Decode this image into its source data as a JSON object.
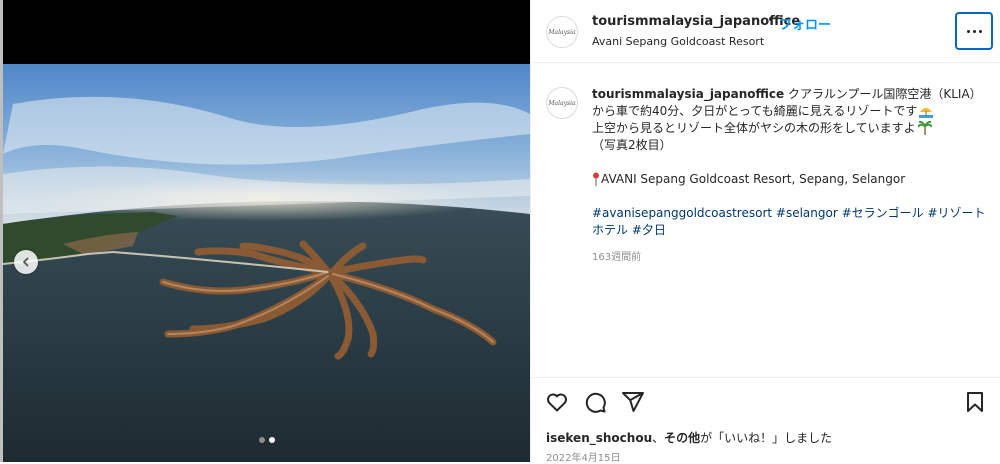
{
  "post": {
    "username": "tourismmalaysia_japanoffice",
    "separator": "•",
    "follow_label": "フォロー",
    "location": "Avani Sepang Goldcoast Resort",
    "avatar_text": "Malaysia",
    "caption": {
      "username": "tourismmalaysia_japanoffice",
      "line1": "クアラルンプール国際空港（KLIA）",
      "line2": "から車で約40分、夕日がとっても綺麗に見えるリゾートです",
      "line3": "上空から見るとリゾート全体がヤシの木の形をしていますよ",
      "line4": "（写真2枚目）",
      "location_line": "AVANI Sepang Goldcoast Resort, Sepang, Selangor",
      "tags_line1": "#avanisepanggoldcoastresort #selangor #セランゴール #リゾート",
      "tags_line2": "ホテル #夕日"
    },
    "time_ago": "163週間前",
    "likes": {
      "user": "iseken_shochou",
      "separator": "、",
      "others": "その他",
      "suffix": "が「いいね！」しました"
    },
    "date": "2022年4月15日"
  },
  "carousel": {
    "total": 2,
    "active_index": 1
  },
  "icons": {
    "more": "more-options-icon",
    "prev": "chevron-left-icon",
    "like": "heart-icon",
    "comment": "comment-icon",
    "share": "share-icon",
    "save": "bookmark-icon",
    "pin": "pin-icon",
    "beach": "beach-umbrella-icon",
    "palm": "palm-tree-icon"
  },
  "colors": {
    "accent": "#0095f6",
    "hashtag": "#00376b",
    "muted": "#8e8e8e",
    "focus": "#0a66c2"
  }
}
